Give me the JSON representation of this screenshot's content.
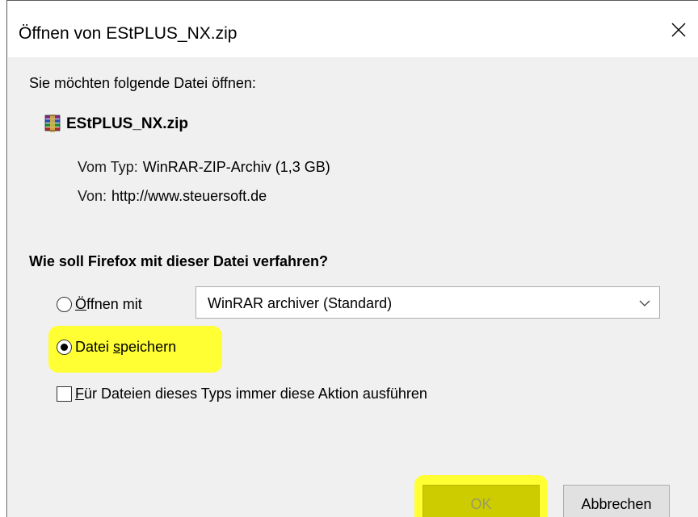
{
  "dialog": {
    "title": "Öffnen von EStPLUS_NX.zip",
    "close_icon": "close-icon",
    "prompt": "Sie möchten folgende Datei öffnen:",
    "file": {
      "icon": "winrar-archive-icon",
      "name": "EStPLUS_NX.zip",
      "type_label": "Vom Typ:",
      "type_value": "WinRAR-ZIP-Archiv (1,3 GB)",
      "from_label": "Von:",
      "from_value": "http://www.steuersoft.de"
    },
    "question": "Wie soll Firefox mit dieser Datei verfahren?",
    "options": {
      "open_with": {
        "label_accel": "Ö",
        "label_rest": "ffnen mit",
        "selected": false
      },
      "app_select": {
        "value": "WinRAR archiver (Standard)"
      },
      "save_file": {
        "label_pre": "Datei ",
        "label_accel": "s",
        "label_rest": "peichern",
        "selected": true
      },
      "always_do": {
        "label_accel": "F",
        "label_rest": "ür Dateien dieses Typs immer diese Aktion ausführen",
        "checked": false
      }
    },
    "buttons": {
      "ok": "OK",
      "cancel": "Abbrechen"
    }
  },
  "colors": {
    "highlight": "#ffff33",
    "dialog_body": "#f0f0f0",
    "ok_highlight": "#cccc00"
  }
}
